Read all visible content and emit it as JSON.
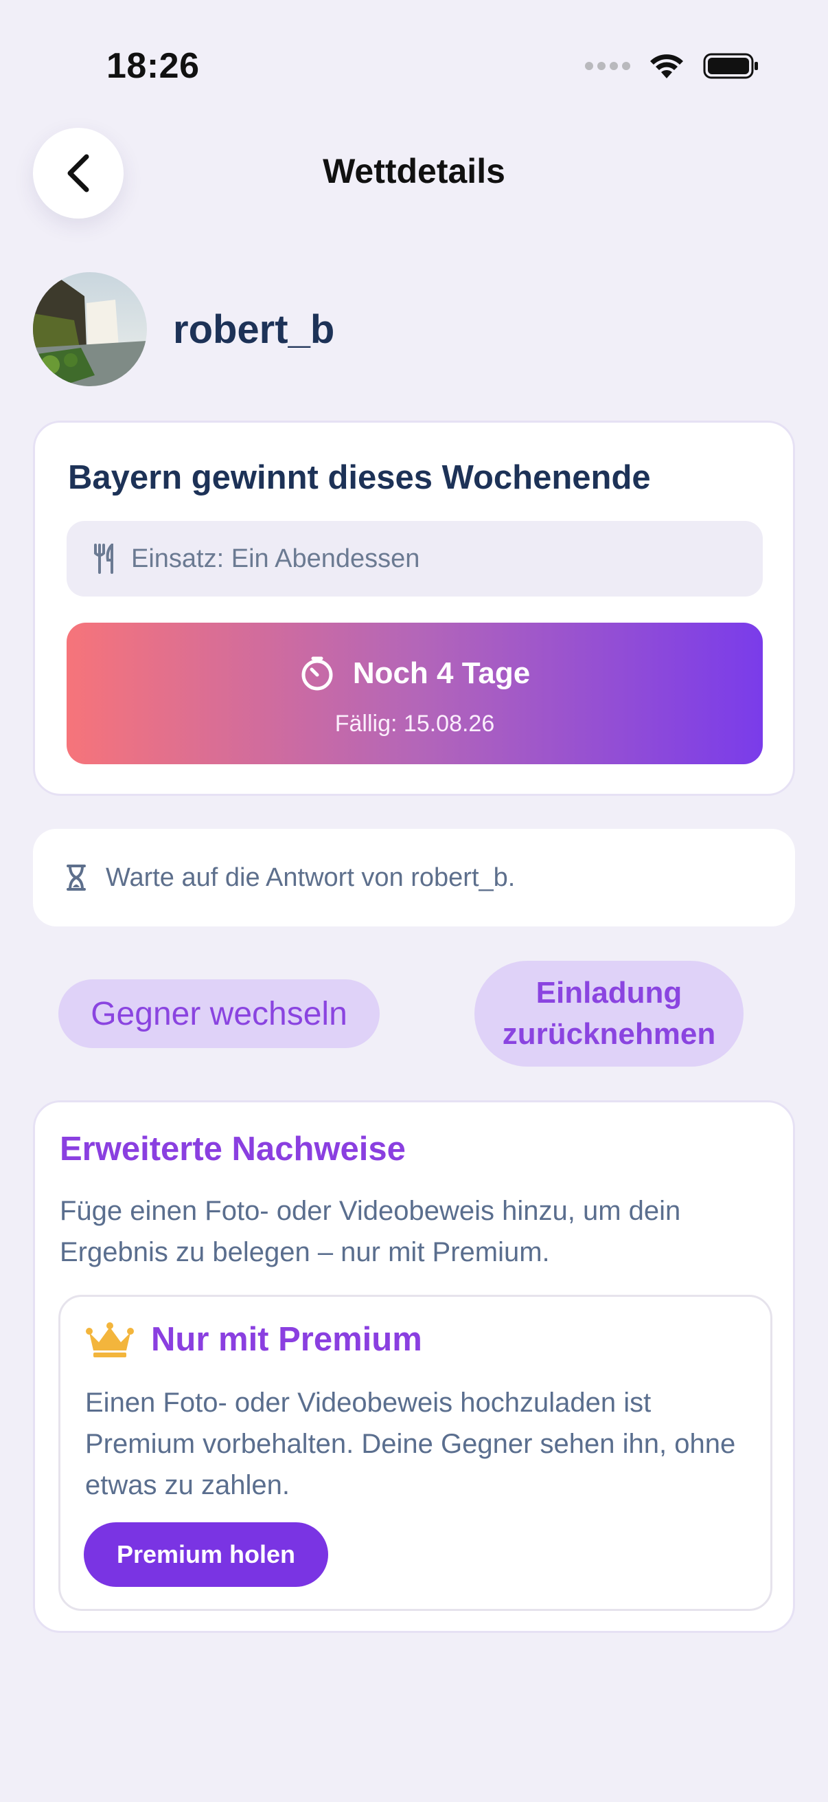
{
  "status_bar": {
    "time": "18:26"
  },
  "header": {
    "title": "Wettdetails"
  },
  "opponent": {
    "username": "robert_b"
  },
  "bet": {
    "title": "Bayern gewinnt dieses Wochenende",
    "stake": "Einsatz: Ein Abendessen",
    "countdown": "Noch 4 Tage",
    "due": "Fällig: 15.08.26"
  },
  "waiting": {
    "message": "Warte auf die Antwort von robert_b."
  },
  "actions": {
    "change_opponent": "Gegner wechseln",
    "revoke_line1": "Einladung",
    "revoke_line2": "zurücknehmen"
  },
  "proof": {
    "title": "Erweiterte Nachweise",
    "description": "Füge einen Foto- oder Videobeweis hinzu, um dein Ergebnis zu belegen – nur mit Premium.",
    "premium": {
      "title": "Nur mit Premium",
      "description": "Einen Foto- oder Videobeweis hochzuladen ist Premium vorbehalten. Deine Gegner sehen ihn, ohne etwas zu zahlen.",
      "button": "Premium holen"
    }
  },
  "colors": {
    "background": "#f1eff8",
    "accent_purple": "#7a34e3",
    "gradient_start": "#f6747a",
    "gradient_end": "#7a3cea",
    "pill_bg": "#dfd2f8",
    "crown": "#f3b53c"
  }
}
